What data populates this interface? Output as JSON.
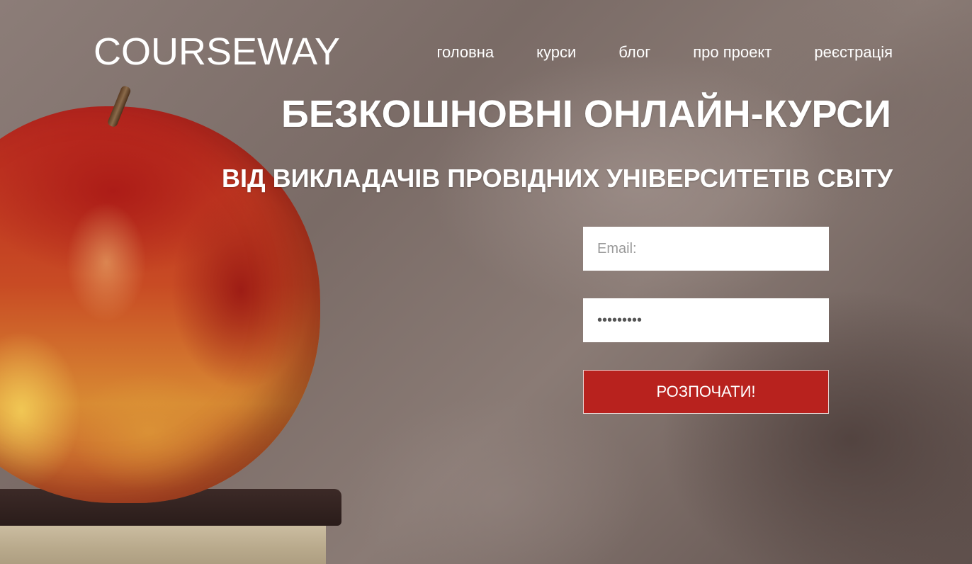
{
  "header": {
    "logo": "COURSEWAY",
    "nav": [
      {
        "label": "головна"
      },
      {
        "label": "курси"
      },
      {
        "label": "блог"
      },
      {
        "label": "про проект"
      },
      {
        "label": "реєстрація"
      }
    ]
  },
  "hero": {
    "title": "БЕЗКОШНОВНІ ОНЛАЙН-КУРСИ",
    "subtitle": "ВІД ВИКЛАДАЧІВ ПРОВІДНИХ УНІВЕРСИТЕТІВ СВІТУ"
  },
  "form": {
    "email": {
      "placeholder": "Email:",
      "value": ""
    },
    "password": {
      "value": "•••••••••"
    },
    "submit_label": "РОЗПОЧАТИ!"
  },
  "colors": {
    "accent": "#b8221e",
    "text": "#ffffff"
  }
}
